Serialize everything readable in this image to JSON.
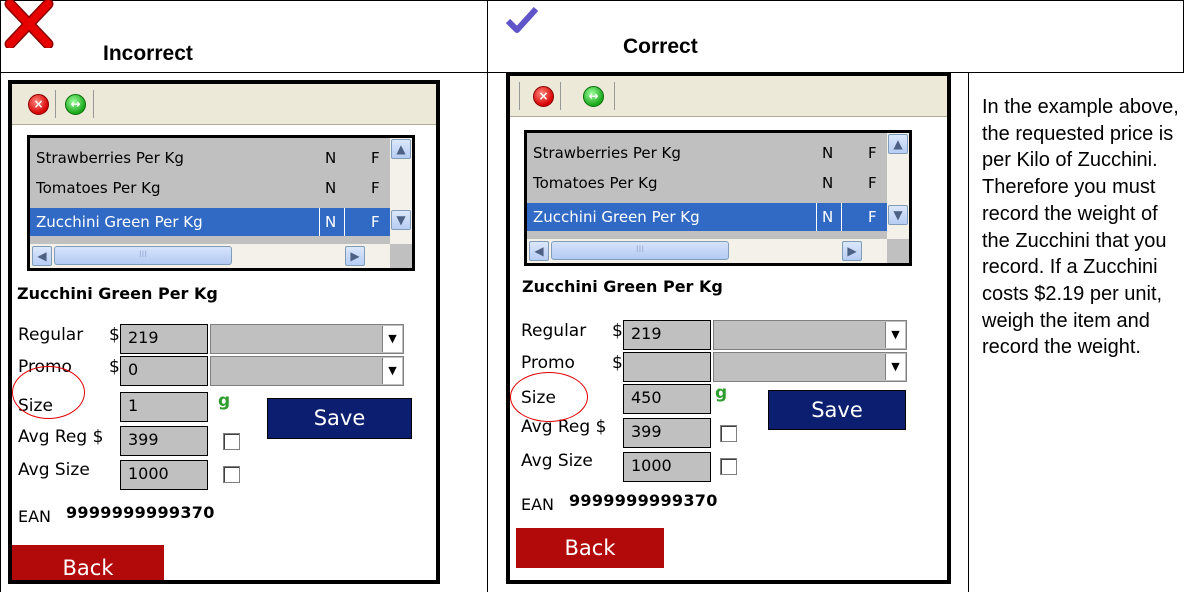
{
  "headers": {
    "incorrect": "Incorrect",
    "correct": "Correct"
  },
  "colors": {
    "cross": "#e60000",
    "check": "#5f55c8",
    "selection": "#316ac5",
    "save_bg": "#0b1e70",
    "back_bg": "#b20a0a",
    "unit": "#2e9d2e"
  },
  "incorrect_screen": {
    "list_rows": [
      {
        "name": "Strawberries Per Kg",
        "col2": "N",
        "col3": "F"
      },
      {
        "name": "Tomatoes Per Kg",
        "col2": "N",
        "col3": "F"
      },
      {
        "name": "Zucchini Green Per Kg",
        "col2": "N",
        "col3": "F"
      }
    ],
    "scroll_thumb_mark": "III",
    "item_name": "Zucchini Green Per Kg",
    "regular_label": "Regular",
    "regular_currency": "$",
    "regular_value": "219",
    "promo_label": "Promo",
    "promo_currency": "$",
    "promo_value": "0",
    "size_label": "Size",
    "size_value": "1",
    "size_unit": "g",
    "save_label": "Save",
    "avg_reg_label": "Avg Reg $",
    "avg_reg_value": "399",
    "avg_size_label": "Avg Size",
    "avg_size_value": "1000",
    "ean_label": "EAN",
    "ean_value": "9999999999370",
    "back_label": "Back"
  },
  "correct_screen": {
    "list_rows": [
      {
        "name": "Strawberries Per Kg",
        "col2": "N",
        "col3": "F"
      },
      {
        "name": "Tomatoes Per Kg",
        "col2": "N",
        "col3": "F"
      },
      {
        "name": "Zucchini Green Per Kg",
        "col2": "N",
        "col3": "F"
      }
    ],
    "scroll_thumb_mark": "III",
    "item_name": "Zucchini Green Per Kg",
    "regular_label": "Regular",
    "regular_currency": "$",
    "regular_value": "219",
    "promo_label": "Promo",
    "promo_currency": "$",
    "promo_value": "",
    "size_label": "Size",
    "size_value": "450",
    "size_unit": "g",
    "save_label": "Save",
    "avg_reg_label": "Avg Reg $",
    "avg_reg_value": "399",
    "avg_size_label": "Avg Size",
    "avg_size_value": "1000",
    "ean_label": "EAN",
    "ean_value": "9999999999370",
    "back_label": "Back"
  },
  "description": "In the example above, the requested price is per Kilo of Zucchini. Therefore you must record the weight of the Zucchini that you record. If a Zucchini costs $2.19 per unit, weigh the item and record the weight."
}
